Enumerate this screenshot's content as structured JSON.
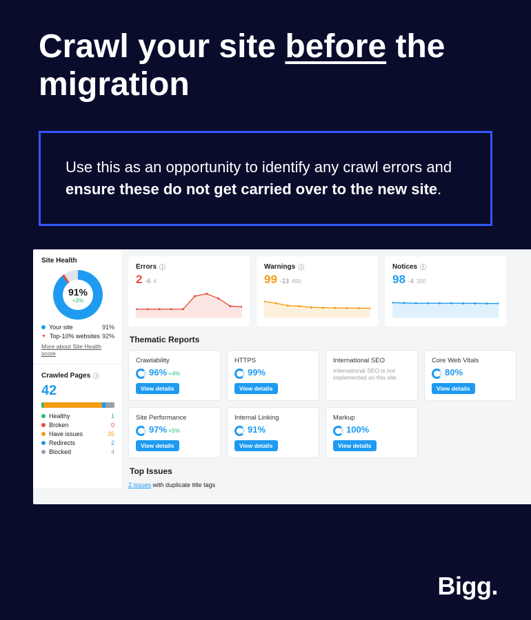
{
  "headline": {
    "pre": "Crawl your site ",
    "underlined": "before",
    "post": " the migration"
  },
  "callout": {
    "lead": "Use this as an opportunity to identify any crawl errors and ",
    "bold": "ensure these do not get carried over to the new site",
    "tail": "."
  },
  "brand": "Bigg",
  "dash": {
    "site_health": {
      "title": "Site Health",
      "pct": "91%",
      "delta": "+3%",
      "legend": [
        {
          "label": "Your site",
          "value": "91%",
          "color": "#1E9BF0"
        },
        {
          "label": "Top-10% websites",
          "value": "92%",
          "caret": true
        }
      ],
      "more": "More about Site Health score"
    },
    "crawled": {
      "title": "Crawled Pages",
      "value": "42",
      "bar": [
        {
          "color": "#1DBF73",
          "w": 3
        },
        {
          "color": "#F39C12",
          "w": 80
        },
        {
          "color": "#1E9BF0",
          "w": 5
        },
        {
          "color": "#9AA0A6",
          "w": 12
        }
      ],
      "breakdown": [
        {
          "label": "Healthy",
          "value": "1",
          "color": "#1DBF73"
        },
        {
          "label": "Broken",
          "value": "0",
          "color": "#E74C3C"
        },
        {
          "label": "Have issues",
          "value": "35",
          "color": "#F39C12"
        },
        {
          "label": "Redirects",
          "value": "2",
          "color": "#1E9BF0"
        },
        {
          "label": "Blocked",
          "value": "4",
          "color": "#9AA0A6"
        }
      ]
    },
    "metrics": [
      {
        "title": "Errors",
        "value": "2",
        "delta": "-6",
        "color": "#E74C3C",
        "axis": "4"
      },
      {
        "title": "Warnings",
        "value": "99",
        "delta": "-13",
        "color": "#F39C12",
        "axis": "400"
      },
      {
        "title": "Notices",
        "value": "98",
        "delta": "-4",
        "color": "#1E9BF0",
        "axis": "200"
      }
    ],
    "thematic_title": "Thematic Reports",
    "reports": [
      {
        "name": "Crawlability",
        "value": "96%",
        "delta": "+4%"
      },
      {
        "name": "HTTPS",
        "value": "99%",
        "delta": ""
      },
      {
        "name": "International SEO",
        "muted": "International SEO is not implemented on this site."
      },
      {
        "name": "Core Web Vitals",
        "value": "80%",
        "delta": ""
      },
      {
        "name": "Site Performance",
        "value": "97%",
        "delta": "+5%"
      },
      {
        "name": "Internal Linking",
        "value": "91%",
        "delta": ""
      },
      {
        "name": "Markup",
        "value": "100%",
        "delta": ""
      }
    ],
    "view_details": "View details",
    "top_issues": {
      "title": "Top Issues",
      "link_text": "2 issues",
      "rest": " with duplicate title tags"
    }
  },
  "chart_data": [
    {
      "type": "line",
      "title": "Errors",
      "ylim": [
        0,
        4
      ],
      "values": [
        1,
        1,
        1,
        1,
        1,
        3.2,
        3.6,
        2.8,
        1.5,
        1.4
      ]
    },
    {
      "type": "line",
      "title": "Warnings",
      "ylim": [
        0,
        400
      ],
      "values": [
        230,
        200,
        160,
        150,
        130,
        125,
        120,
        118,
        116,
        115
      ]
    },
    {
      "type": "line",
      "title": "Notices",
      "ylim": [
        0,
        200
      ],
      "values": [
        105,
        102,
        100,
        100,
        100,
        100,
        99,
        99,
        98,
        98
      ]
    }
  ]
}
